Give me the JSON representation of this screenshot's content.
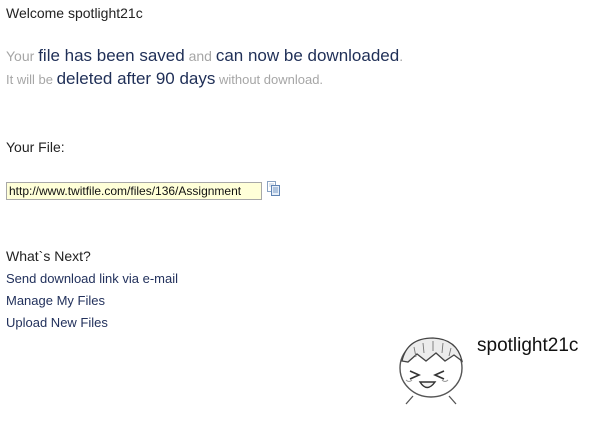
{
  "header": {
    "welcome": "Welcome spotlight21c"
  },
  "message": {
    "l1_a": "Your ",
    "l1_b": "file has been saved",
    "l1_c": " and ",
    "l1_d": "can now be downloaded",
    "l1_e": ".",
    "l2_a": "It will be ",
    "l2_b": "deleted after 90 days",
    "l2_c": " without download."
  },
  "file": {
    "label": "Your File:",
    "link": "http://www.twitfile.com/files/136/Assignment",
    "copy_icon": "copy-icon"
  },
  "next": {
    "heading": "What`s Next?",
    "links": [
      "Send download link via e-mail",
      "Manage My Files",
      "Upload New Files"
    ]
  },
  "user": {
    "name": "spotlight21c",
    "avatar_icon": "cartoon-face-avatar"
  }
}
